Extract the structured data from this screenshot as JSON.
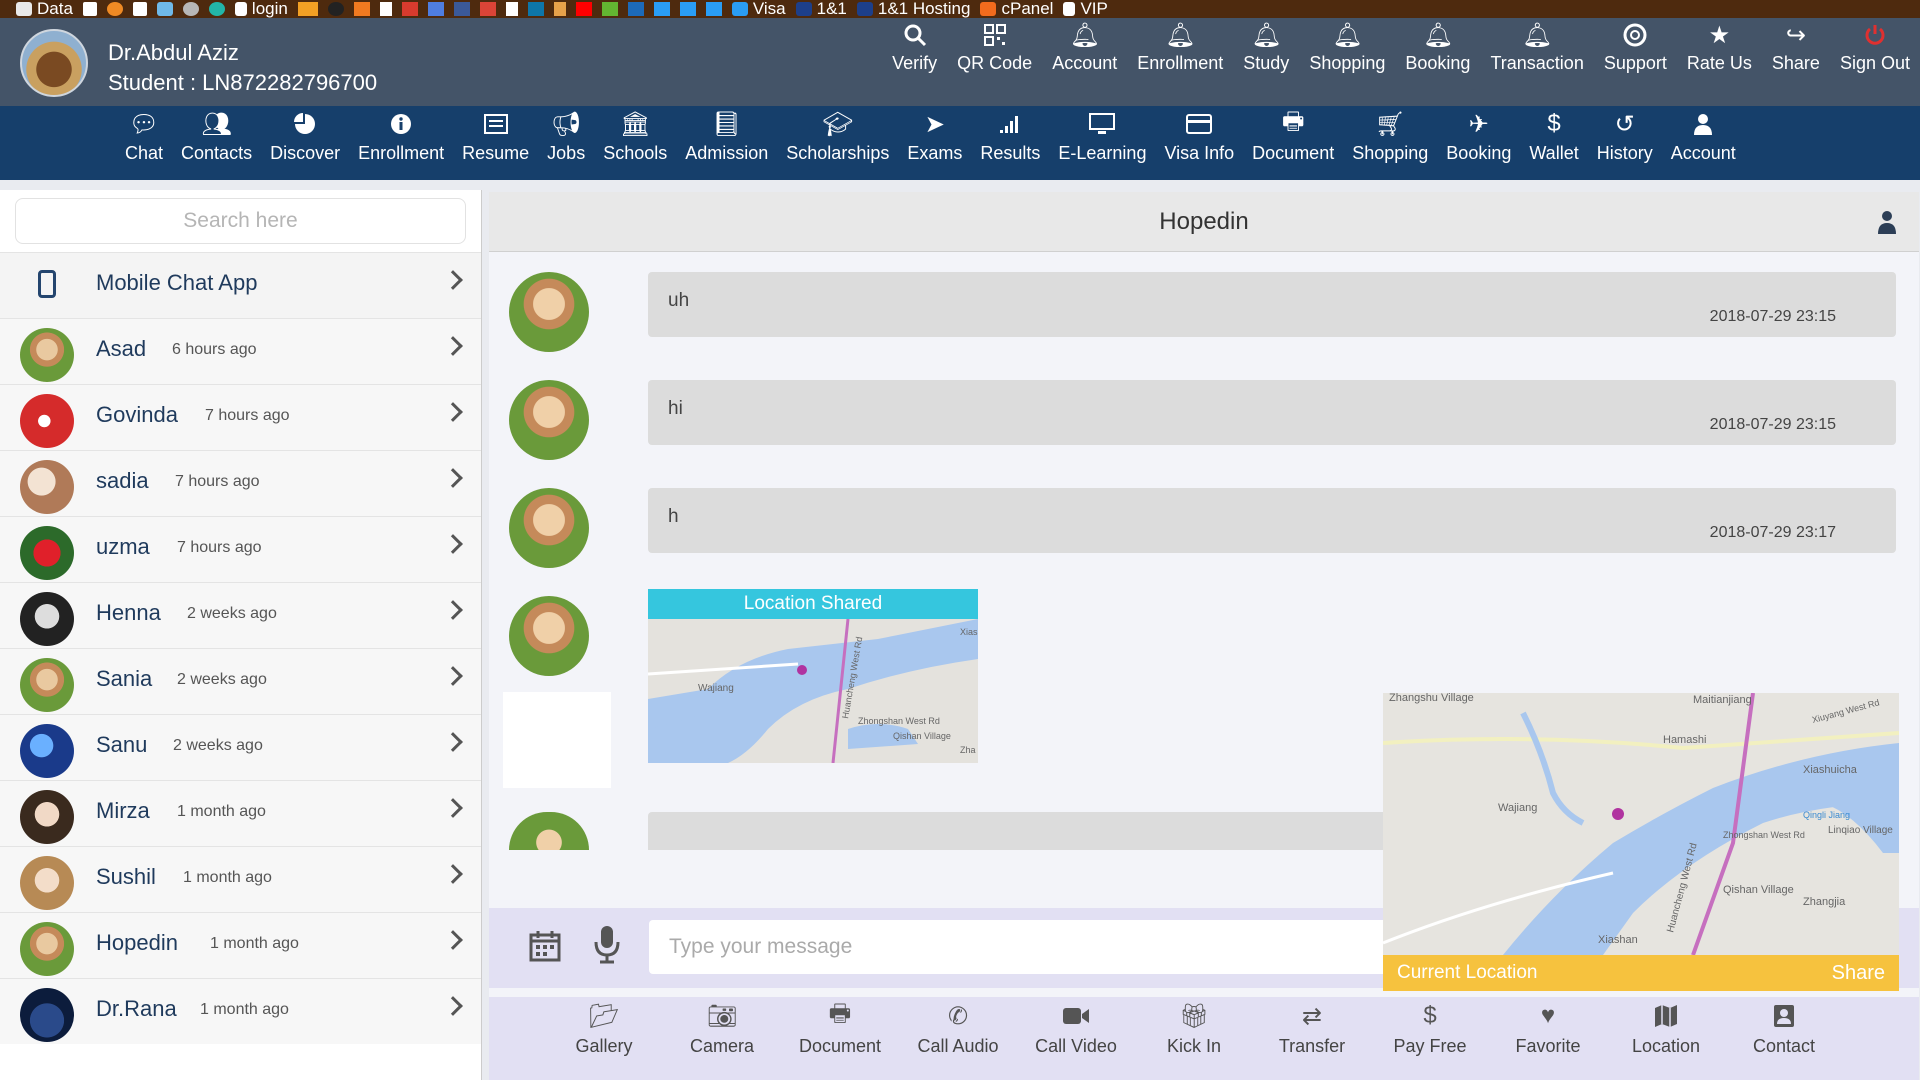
{
  "bookmarks": [
    "Data",
    "login",
    "Visa",
    "1&1",
    "1&1 Hosting",
    "cPanel",
    "VIP"
  ],
  "user": {
    "name": "Dr.Abdul Aziz",
    "student": "Student : LN872282796700"
  },
  "top_nav": [
    {
      "label": "Verify",
      "icon": "search-icon"
    },
    {
      "label": "QR Code",
      "icon": "qr-code-icon"
    },
    {
      "label": "Account",
      "icon": "bell-icon"
    },
    {
      "label": "Enrollment",
      "icon": "bell-icon"
    },
    {
      "label": "Study",
      "icon": "bell-icon"
    },
    {
      "label": "Shopping",
      "icon": "bell-icon"
    },
    {
      "label": "Booking",
      "icon": "bell-icon"
    },
    {
      "label": "Transaction",
      "icon": "bell-icon"
    },
    {
      "label": "Support",
      "icon": "lifebuoy-icon"
    },
    {
      "label": "Rate Us",
      "icon": "star-icon"
    },
    {
      "label": "Share",
      "icon": "share-icon"
    },
    {
      "label": "Sign Out",
      "icon": "power-icon"
    }
  ],
  "main_nav": [
    {
      "label": "Chat",
      "icon": "chat-icon"
    },
    {
      "label": "Contacts",
      "icon": "contacts-icon"
    },
    {
      "label": "Discover",
      "icon": "pie-chart-icon"
    },
    {
      "label": "Enrollment",
      "icon": "info-icon"
    },
    {
      "label": "Resume",
      "icon": "resume-icon"
    },
    {
      "label": "Jobs",
      "icon": "megaphone-icon"
    },
    {
      "label": "Schools",
      "icon": "bank-icon"
    },
    {
      "label": "Admission",
      "icon": "book-icon"
    },
    {
      "label": "Scholarships",
      "icon": "graduation-cap-icon"
    },
    {
      "label": "Exams",
      "icon": "pointer-icon"
    },
    {
      "label": "Results",
      "icon": "signal-icon"
    },
    {
      "label": "E-Learning",
      "icon": "monitor-icon"
    },
    {
      "label": "Visa Info",
      "icon": "card-icon"
    },
    {
      "label": "Document",
      "icon": "printer-icon"
    },
    {
      "label": "Shopping",
      "icon": "cart-icon"
    },
    {
      "label": "Booking",
      "icon": "plane-icon"
    },
    {
      "label": "Wallet",
      "icon": "dollar-icon"
    },
    {
      "label": "History",
      "icon": "history-icon"
    },
    {
      "label": "Account",
      "icon": "user-icon"
    }
  ],
  "sidebar": {
    "search_placeholder": "Search here",
    "mobile_app": "Mobile Chat App",
    "contacts": [
      {
        "name": "Asad",
        "time": "6 hours ago"
      },
      {
        "name": "Govinda",
        "time": "7 hours ago"
      },
      {
        "name": "sadia",
        "time": "7 hours ago"
      },
      {
        "name": "uzma",
        "time": "7 hours ago"
      },
      {
        "name": "Henna",
        "time": "2 weeks ago"
      },
      {
        "name": "Sania",
        "time": "2 weeks ago"
      },
      {
        "name": "Sanu",
        "time": "2 weeks ago"
      },
      {
        "name": "Mirza",
        "time": "1 month ago"
      },
      {
        "name": "Sushil",
        "time": "1 month ago"
      },
      {
        "name": "Hopedin",
        "time": "1 month ago"
      },
      {
        "name": "Dr.Rana",
        "time": "1 month ago"
      }
    ]
  },
  "chat": {
    "title": "Hopedin",
    "messages": [
      {
        "text": "uh",
        "date": "2018-07-29 23:15"
      },
      {
        "text": "hi",
        "date": "2018-07-29 23:15"
      },
      {
        "text": "h",
        "date": "2018-07-29 23:17"
      }
    ],
    "location_shared": "Location Shared",
    "input_placeholder": "Type your message",
    "current_location": "Current Location",
    "share": "Share"
  },
  "map_labels": [
    "Zhangshu Village",
    "Maitianjiang",
    "Hamashi",
    "Xiuyang West Rd",
    "Xiashuicha",
    "Wajiang",
    "Zhongshan West Rd",
    "Qingli Jiang",
    "Linqiao Village",
    "Huancheng West Rd",
    "Qishan Village",
    "Zhangjia",
    "Xiashan"
  ],
  "small_map_labels": [
    "Wajiang",
    "Zhongshan West Rd",
    "Huancheng West Rd",
    "Qishan Village",
    "Xias",
    "Zha"
  ],
  "actions": [
    {
      "label": "Gallery",
      "icon": "folder-icon"
    },
    {
      "label": "Camera",
      "icon": "camera-icon"
    },
    {
      "label": "Document",
      "icon": "printer-icon"
    },
    {
      "label": "Call Audio",
      "icon": "phone-icon"
    },
    {
      "label": "Call Video",
      "icon": "video-camera-icon"
    },
    {
      "label": "Kick In",
      "icon": "gift-icon"
    },
    {
      "label": "Transfer",
      "icon": "transfer-icon"
    },
    {
      "label": "Pay Free",
      "icon": "dollar-icon"
    },
    {
      "label": "Favorite",
      "icon": "heart-icon"
    },
    {
      "label": "Location",
      "icon": "map-icon"
    },
    {
      "label": "Contact",
      "icon": "contact-card-icon"
    }
  ],
  "colors": {
    "header": "#445468",
    "nav": "#163f6b",
    "accent": "#35c6de",
    "current_loc": "#f6c23e"
  }
}
